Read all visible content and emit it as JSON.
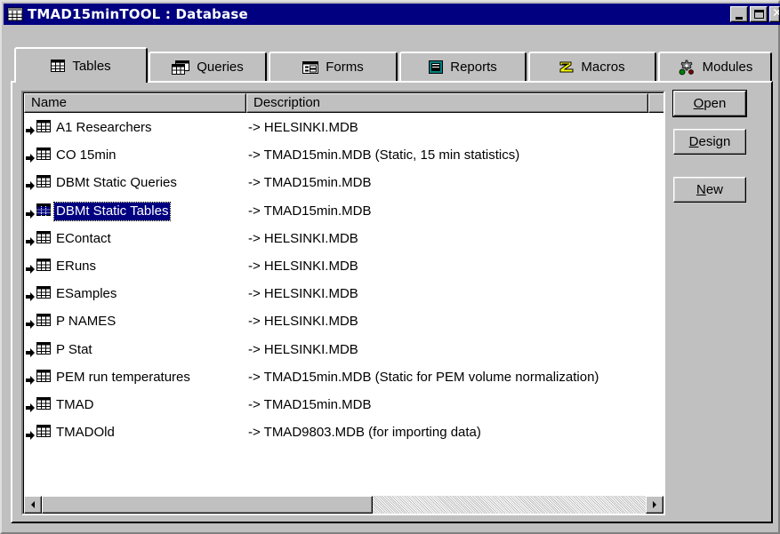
{
  "window": {
    "title": "TMAD15minTOOL : Database"
  },
  "tabs": [
    {
      "label": "Tables",
      "icon": "table-icon",
      "active": true
    },
    {
      "label": "Queries",
      "icon": "query-icon",
      "active": false
    },
    {
      "label": "Forms",
      "icon": "form-icon",
      "active": false
    },
    {
      "label": "Reports",
      "icon": "report-icon",
      "active": false
    },
    {
      "label": "Macros",
      "icon": "macro-icon",
      "active": false
    },
    {
      "label": "Modules",
      "icon": "module-icon",
      "active": false
    }
  ],
  "list": {
    "columns": {
      "name": "Name",
      "description": "Description"
    },
    "rows": [
      {
        "name": "A1 Researchers",
        "description": "-> HELSINKI.MDB"
      },
      {
        "name": "CO 15min",
        "description": "-> TMAD15min.MDB (Static, 15 min statistics)"
      },
      {
        "name": "DBMt Static Queries",
        "description": "-> TMAD15min.MDB"
      },
      {
        "name": "DBMt Static Tables",
        "description": "-> TMAD15min.MDB",
        "selected": true
      },
      {
        "name": "EContact",
        "description": "-> HELSINKI.MDB"
      },
      {
        "name": "ERuns",
        "description": "-> HELSINKI.MDB"
      },
      {
        "name": "ESamples",
        "description": "-> HELSINKI.MDB"
      },
      {
        "name": "P NAMES",
        "description": "-> HELSINKI.MDB"
      },
      {
        "name": "P Stat",
        "description": "-> HELSINKI.MDB"
      },
      {
        "name": "PEM run temperatures",
        "description": "-> TMAD15min.MDB (Static for PEM volume normalization)"
      },
      {
        "name": "TMAD",
        "description": "-> TMAD15min.MDB"
      },
      {
        "name": "TMADOld",
        "description": "-> TMAD9803.MDB (for importing data)"
      }
    ]
  },
  "buttons": {
    "open": {
      "first": "O",
      "rest": "pen"
    },
    "design": {
      "first": "D",
      "rest": "esign"
    },
    "new": {
      "first": "N",
      "rest": "ew"
    }
  },
  "colors": {
    "titlebar": "#000080",
    "face": "#c0c0c0",
    "selection": "#000080"
  }
}
